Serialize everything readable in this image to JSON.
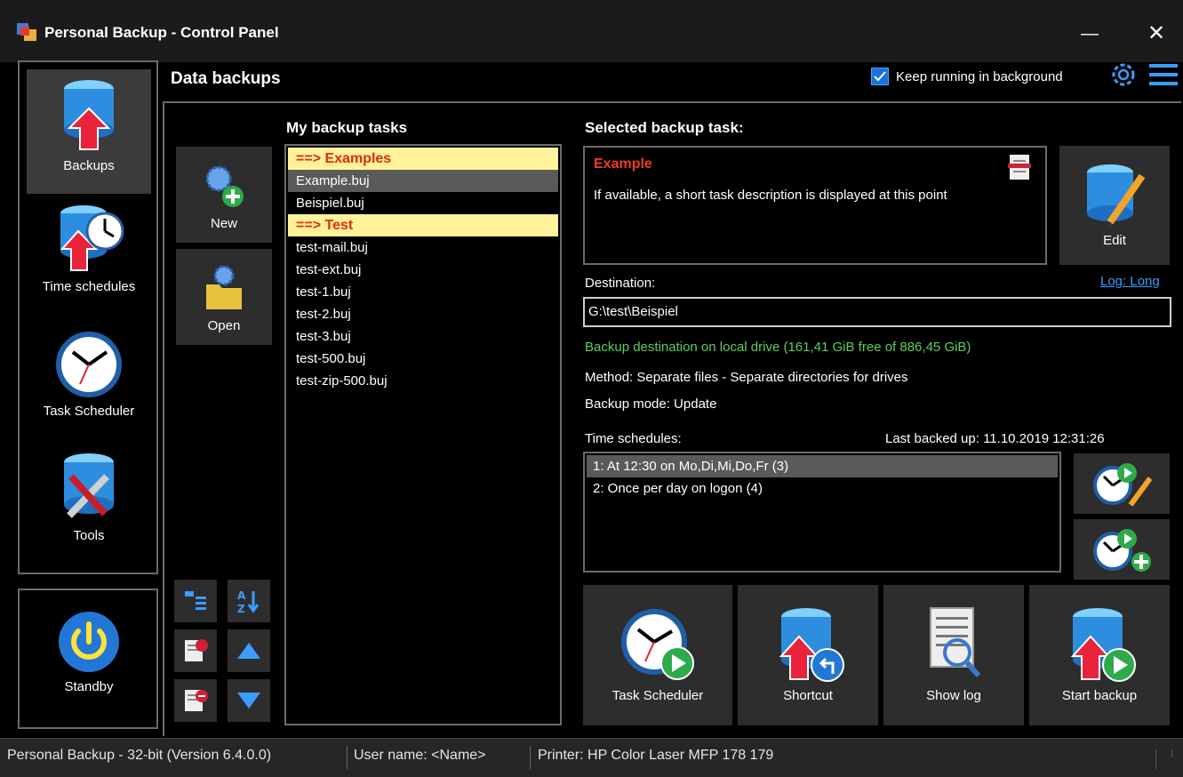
{
  "window": {
    "title": "Personal Backup - Control Panel",
    "minimize_glyph": "—",
    "close_glyph": "✕"
  },
  "nav": {
    "items": [
      {
        "label": "Backups",
        "icon": "database-upload-icon",
        "selected": true
      },
      {
        "label": "Time schedules",
        "icon": "database-clock-icon",
        "selected": false
      },
      {
        "label": "Task Scheduler",
        "icon": "clock-icon",
        "selected": false
      },
      {
        "label": "Tools",
        "icon": "tools-icon",
        "selected": false
      }
    ],
    "standby_label": "Standby"
  },
  "header": {
    "title": "Data backups",
    "keep_running_label": "Keep running in background",
    "keep_running_checked": true
  },
  "tasks": {
    "title": "My backup tasks",
    "new_label": "New",
    "open_label": "Open",
    "items": [
      {
        "label": "==> Examples",
        "kind": "header"
      },
      {
        "label": "Example.buj",
        "kind": "item",
        "selected": true
      },
      {
        "label": "Beispiel.buj",
        "kind": "item"
      },
      {
        "label": "==> Test",
        "kind": "header"
      },
      {
        "label": "test-mail.buj",
        "kind": "item"
      },
      {
        "label": "test-ext.buj",
        "kind": "item"
      },
      {
        "label": "test-1.buj",
        "kind": "item"
      },
      {
        "label": "test-2.buj",
        "kind": "item"
      },
      {
        "label": "test-3.buj",
        "kind": "item"
      },
      {
        "label": "test-500.buj",
        "kind": "item"
      },
      {
        "label": "test-zip-500.buj",
        "kind": "item"
      }
    ]
  },
  "selected": {
    "title": "Selected backup task:",
    "name": "Example",
    "description": "If available, a short task description is displayed at this point",
    "edit_label": "Edit",
    "destination_label": "Destination:",
    "log_link": "Log: Long",
    "destination_value": "G:\\test\\Beispiel",
    "destination_info": "Backup destination on local drive (161,41 GiB free of 886,45 GiB)",
    "method": "Method: Separate files - Separate directories for drives",
    "mode": "Backup mode: Update",
    "schedules_label": "Time schedules:",
    "last_backed_up": "Last backed up: 11.10.2019 12:31:26",
    "schedules": [
      "1: At 12:30 on Mo,Di,Mi,Do,Fr (3)",
      "2: Once per day on logon (4)"
    ]
  },
  "actions": {
    "task_scheduler": "Task Scheduler",
    "shortcut": "Shortcut",
    "show_log": "Show log",
    "start_backup": "Start backup"
  },
  "status": {
    "app": "Personal Backup - 32-bit (Version 6.4.0.0)",
    "user": "User name: <Name>",
    "printer": "Printer: HP Color Laser MFP 178 179"
  },
  "colors": {
    "accent_blue": "#1a73d9",
    "header_yellow": "#fff29a",
    "header_red": "#e02a12",
    "info_green": "#5ccf5c",
    "link_blue": "#3b9dff"
  }
}
